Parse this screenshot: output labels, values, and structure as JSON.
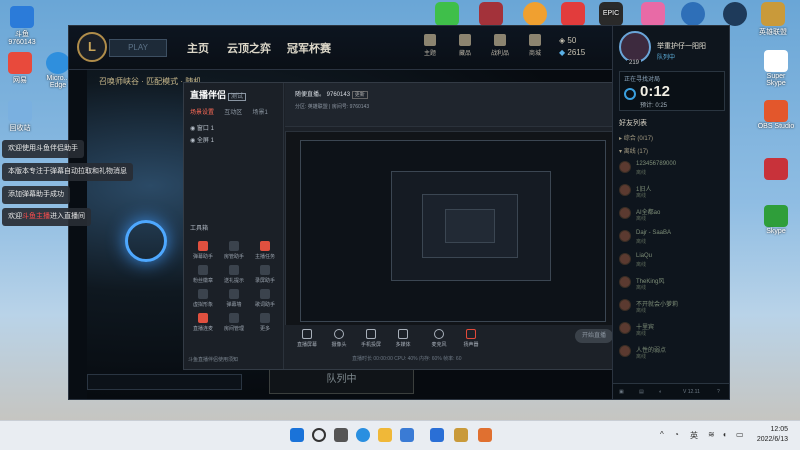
{
  "desktop": {
    "left_icons": [
      {
        "label": "斗鱼",
        "sub": "9760143",
        "color": "#2b7bd9"
      },
      {
        "label": "网易",
        "sub": "",
        "color": "#e84a3c"
      },
      {
        "label": "Micro... Edge",
        "sub": "",
        "color": "#2f8fdd"
      },
      {
        "label": "回收站",
        "sub": "",
        "color": "#7ab0e0"
      }
    ],
    "top_icons": [
      {
        "label": "",
        "color": "#3fbf4a"
      },
      {
        "label": "",
        "color": "#a3323a"
      },
      {
        "label": "",
        "color": "#f0a030"
      },
      {
        "label": "",
        "color": "#e23c3c"
      },
      {
        "label": "EPIC",
        "color": "#2a2a2a"
      },
      {
        "label": "",
        "color": "#e86aa6"
      },
      {
        "label": "",
        "color": "#2e6fb8"
      },
      {
        "label": "",
        "color": "#1e3a5a"
      },
      {
        "label": "英雄联盟",
        "color": "#c99a3a"
      }
    ],
    "right_icons": [
      {
        "label": "Super Skype",
        "color": "#ffffff"
      },
      {
        "label": "OBS Studio",
        "color": "#e3572c"
      },
      {
        "label": "",
        "color": "#c8323a"
      },
      {
        "label": "Skype",
        "color": "#2f9e3a"
      }
    ]
  },
  "notifications": [
    {
      "text": "欢迎使用斗鱼伴侣助手"
    },
    {
      "text": "本版本专注于弹幕自动拉取和礼物消息"
    },
    {
      "text": "添加弹幕助手成功"
    },
    {
      "text_pre": "欢迎",
      "text_hl": "斗鱼主播",
      "text_post": "进入直播间"
    }
  ],
  "client": {
    "logo": "L",
    "play_label": "PLAY",
    "nav": [
      "主页",
      "云顶之弈",
      "冠军杯赛"
    ],
    "top_icons": [
      "主题",
      "藏品",
      "战利品",
      "商城"
    ],
    "currency": {
      "rp": "50",
      "be": "2615"
    },
    "subtitle": "召唤师峡谷 · 匹配模式 · 随机",
    "queue_label": "队列中",
    "queue_close": "✕"
  },
  "stream": {
    "app_name": "直播伴侣",
    "version_badge": "测试",
    "tabs": [
      "场景设置",
      "互动区",
      "场景1"
    ],
    "active_tab": 0,
    "scenes": [
      "窗口 1",
      "全屏 1"
    ],
    "tools_title": "工具箱",
    "tools": [
      "弹幕助手",
      "房管助手",
      "主播任务",
      "粉丝徽章",
      "送礼提示",
      "录屏助手",
      "虚拟形象",
      "弹幕墙",
      "歌词助手",
      "直播连麦",
      "房间管理",
      "更多"
    ],
    "header_title": "随便直播。 9760143",
    "header_tag": "更新",
    "header_sub": "分区: 英雄联盟 | 房间号: 9760143",
    "bottom": [
      "直播屏幕",
      "摄像头",
      "手机投屏",
      "多媒体",
      "麦克风",
      "扬声器"
    ],
    "start_btn": "开始直播",
    "footer": "斗鱼直播伴侣使用须知",
    "status": "直播时长 00:00:00  CPU: 40%  内存: 60%  帧率: 60"
  },
  "friends": {
    "level": "219",
    "name": "举重护仔一阳阳",
    "status": "队列中",
    "queue_label": "正在寻找对局",
    "timer": "0:12",
    "timer_sub": "预计: 0:25",
    "title": "好友列表",
    "groups": [
      {
        "label": "综合 (0/17)"
      },
      {
        "label": "离线 (17)"
      }
    ],
    "list": [
      {
        "name": "123456789000",
        "status": "离线"
      },
      {
        "name": "1旧人",
        "status": "离线"
      },
      {
        "name": "AI全都ao",
        "status": "离线"
      },
      {
        "name": "Dajr - SaaBA",
        "status": "离线"
      },
      {
        "name": "LiaQu",
        "status": "离线"
      },
      {
        "name": "TheKing风",
        "status": "离线"
      },
      {
        "name": "不开就会小萝莉",
        "status": "离线"
      },
      {
        "name": "十里宾",
        "status": "离线"
      },
      {
        "name": "人性的弱点",
        "status": "离线"
      }
    ],
    "footer_version": "V 12.11"
  },
  "taskbar": {
    "apps": [
      {
        "name": "windows",
        "color": "#1a73d9"
      },
      {
        "name": "search",
        "color": "#333333"
      },
      {
        "name": "task-view",
        "color": "#555555"
      },
      {
        "name": "edge",
        "color": "#2a8fe0"
      },
      {
        "name": "explorer",
        "color": "#f0b838"
      },
      {
        "name": "store",
        "color": "#3a7bd5"
      },
      {
        "name": "douyu",
        "color": "#2a6fd6"
      },
      {
        "name": "lol",
        "color": "#c99a3a"
      },
      {
        "name": "companion",
        "color": "#e07030"
      }
    ],
    "ime": "英",
    "time": "12:05",
    "date": "2022/6/13"
  }
}
